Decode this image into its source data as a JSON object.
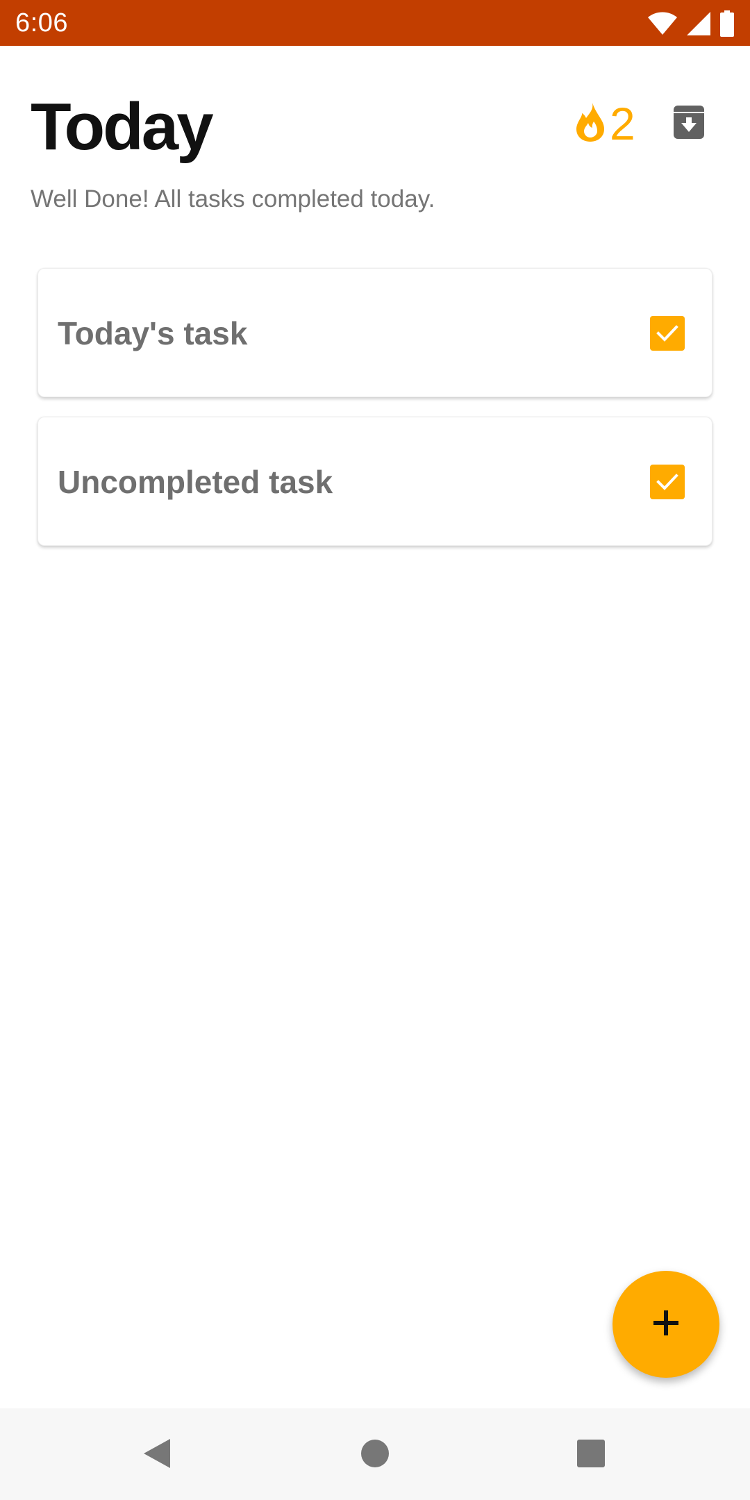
{
  "status_bar": {
    "time": "6:06",
    "background_color": "#C23E00",
    "icons": [
      "wifi-icon",
      "signal-icon",
      "battery-icon"
    ]
  },
  "header": {
    "title": "Today",
    "streak_icon": "fire-icon",
    "streak_count": "2",
    "streak_color": "#FFAB00",
    "archive_icon": "archive-icon"
  },
  "subtitle": "Well Done! All tasks completed today.",
  "tasks": [
    {
      "label": "Today's task",
      "checked": true
    },
    {
      "label": "Uncompleted task",
      "checked": true
    }
  ],
  "fab": {
    "icon": "plus-icon",
    "color": "#FFAB00"
  },
  "nav_bar": {
    "buttons": [
      "back-icon",
      "home-icon",
      "recents-icon"
    ]
  }
}
